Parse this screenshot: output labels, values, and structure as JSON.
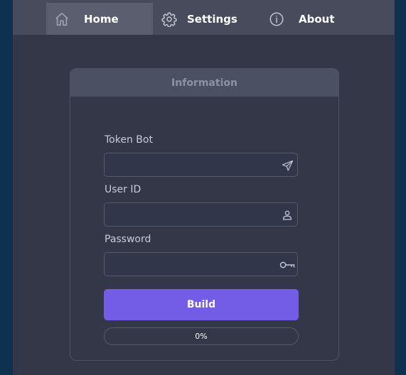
{
  "nav": {
    "items": [
      {
        "label": "Home",
        "icon": "home-icon",
        "active": true
      },
      {
        "label": "Settings",
        "icon": "gear-icon",
        "active": false
      },
      {
        "label": "About",
        "icon": "info-icon",
        "active": false
      }
    ]
  },
  "card": {
    "title": "Information",
    "fields": [
      {
        "label": "Token Bot",
        "value": "",
        "placeholder": "",
        "icon": "send-icon"
      },
      {
        "label": "User ID",
        "value": "",
        "placeholder": "",
        "icon": "user-icon"
      },
      {
        "label": "Password",
        "value": "",
        "placeholder": "",
        "icon": "key-icon"
      }
    ],
    "build_label": "Build",
    "progress": {
      "value": 0,
      "text": "0%"
    }
  },
  "colors": {
    "background": "#0f3150",
    "window": "#333747",
    "nav_bar": "#474b5c",
    "nav_active": "#5a5e6e",
    "card_header": "#4c5063",
    "accent": "#735de7"
  }
}
